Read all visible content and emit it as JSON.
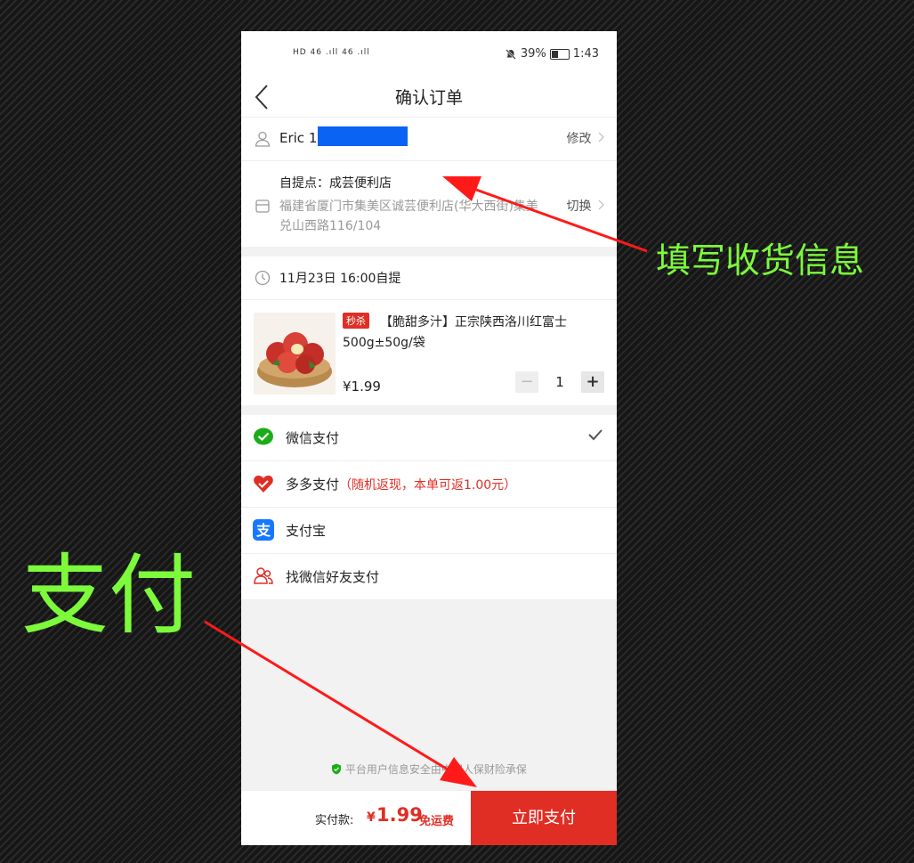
{
  "status_bar": {
    "left_indicators": "HD 46 .ıll 46 .ıll",
    "battery": "39%",
    "time": "1:43"
  },
  "nav": {
    "title": "确认订单"
  },
  "user": {
    "name": "Eric",
    "phone_prefix": "1",
    "edit_label": "修改"
  },
  "pickup": {
    "label": "自提点：成芸便利店",
    "address": "福建省厦门市集美区诚芸便利店(华大西街)集美兑山西路116/104",
    "switch_label": "切换"
  },
  "delivery": {
    "time": "11月23日 16:00自提"
  },
  "product": {
    "tag": "秒杀",
    "title": "【脆甜多汁】正宗陕西洛川红富士500g±50g/袋",
    "price": "¥1.99",
    "quantity": "1",
    "minus": "−",
    "plus": "+"
  },
  "payment_methods": [
    {
      "label": "微信支付",
      "note": "",
      "selected": true,
      "icon": "wechat-pay-icon"
    },
    {
      "label": "多多支付",
      "note": "（随机返现，本单可返1.00元）",
      "selected": false,
      "icon": "duoduo-pay-icon"
    },
    {
      "label": "支付宝",
      "note": "",
      "selected": false,
      "icon": "alipay-icon"
    },
    {
      "label": "找微信好友支付",
      "note": "",
      "selected": false,
      "icon": "friend-pay-icon"
    }
  ],
  "safety": "平台用户信息安全由中国人保财险承保",
  "footer": {
    "total_label": "实付款:",
    "currency": "¥",
    "total_value": "1.99",
    "free_shipping": "免运费",
    "pay_button": "立即支付"
  },
  "annotations": {
    "fill_info": "填写收货信息",
    "pay": "支付"
  },
  "colors": {
    "accent_red": "#e02e24",
    "annotation_green": "#7dfa3c",
    "arrow_red": "#ff1a1a",
    "mask_blue": "#0a63f2"
  }
}
